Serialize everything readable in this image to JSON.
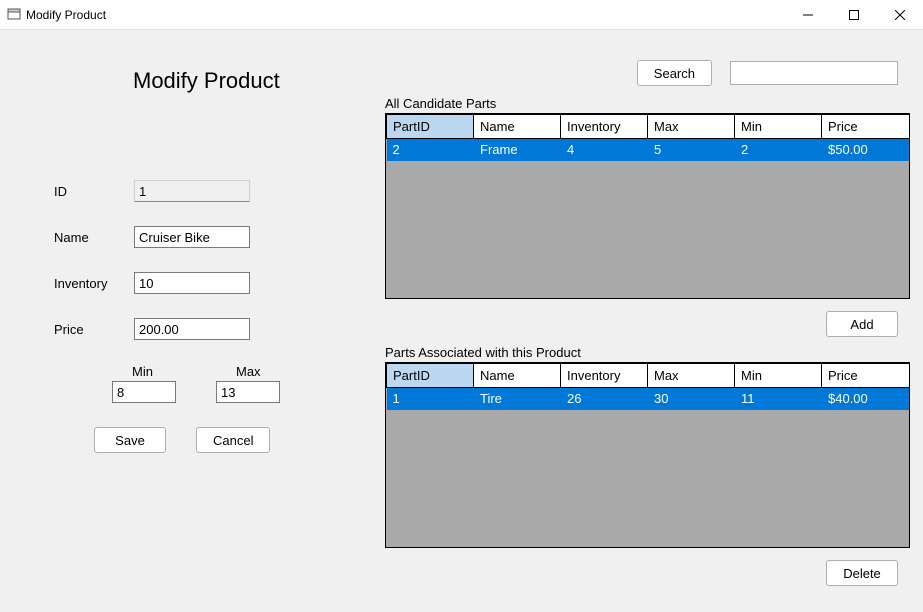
{
  "window": {
    "title": "Modify Product"
  },
  "page_title": "Modify Product",
  "form": {
    "id_label": "ID",
    "id_value": "1",
    "name_label": "Name",
    "name_value": "Cruiser Bike",
    "inventory_label": "Inventory",
    "inventory_value": "10",
    "price_label": "Price",
    "price_value": "200.00",
    "min_label": "Min",
    "min_value": "8",
    "max_label": "Max",
    "max_value": "13",
    "save_label": "Save",
    "cancel_label": "Cancel"
  },
  "search": {
    "button_label": "Search",
    "value": ""
  },
  "candidate": {
    "label": "All Candidate Parts",
    "headers": {
      "partid": "PartID",
      "name": "Name",
      "inventory": "Inventory",
      "max": "Max",
      "min": "Min",
      "price": "Price"
    },
    "rows": [
      {
        "partid": "2",
        "name": "Frame",
        "inventory": "4",
        "max": "5",
        "min": "2",
        "price": "$50.00"
      }
    ],
    "add_label": "Add"
  },
  "associated": {
    "label": "Parts Associated with this Product",
    "headers": {
      "partid": "PartID",
      "name": "Name",
      "inventory": "Inventory",
      "max": "Max",
      "min": "Min",
      "price": "Price"
    },
    "rows": [
      {
        "partid": "1",
        "name": "Tire",
        "inventory": "26",
        "max": "30",
        "min": "11",
        "price": "$40.00"
      }
    ],
    "delete_label": "Delete"
  }
}
